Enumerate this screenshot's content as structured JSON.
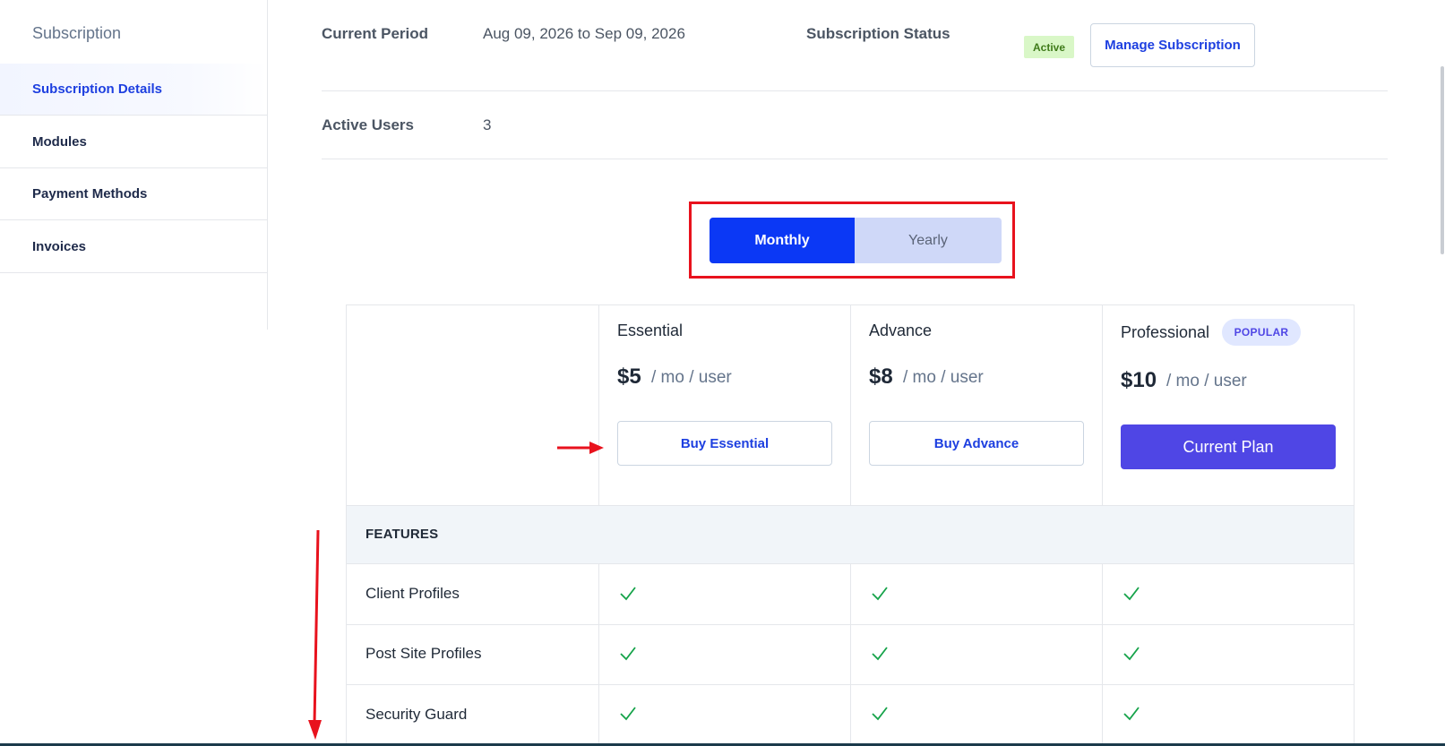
{
  "sidebar": {
    "title": "Subscription",
    "items": [
      {
        "label": "Subscription Details",
        "active": true
      },
      {
        "label": "Modules",
        "active": false
      },
      {
        "label": "Payment Methods",
        "active": false
      },
      {
        "label": "Invoices",
        "active": false
      }
    ]
  },
  "info": {
    "current_period_label": "Current Period",
    "current_period_value": "Aug 09, 2026 to Sep 09, 2026",
    "status_label": "Subscription Status",
    "status_badge": "Active",
    "manage_button": "Manage Subscription",
    "active_users_label": "Active Users",
    "active_users_value": "3"
  },
  "billing_toggle": {
    "monthly": "Monthly",
    "yearly": "Yearly",
    "selected": "Monthly"
  },
  "plans": [
    {
      "name": "Essential",
      "price": "$5",
      "per": "/ mo / user",
      "button": "Buy Essential"
    },
    {
      "name": "Advance",
      "price": "$8",
      "per": "/ mo / user",
      "button": "Buy Advance"
    },
    {
      "name": "Professional",
      "badge": "POPULAR",
      "price": "$10",
      "per": "/ mo / user",
      "button": "Current Plan"
    }
  ],
  "features": {
    "header": "FEATURES",
    "rows": [
      {
        "name": "Client Profiles",
        "essential": true,
        "advance": true,
        "professional": true
      },
      {
        "name": "Post Site Profiles",
        "essential": true,
        "advance": true,
        "professional": true
      },
      {
        "name": "Security Guard",
        "essential": true,
        "advance": true,
        "professional": true
      }
    ]
  },
  "colors": {
    "accent": "#0b38f5",
    "link": "#1d3fe0",
    "current_plan": "#4f46e5",
    "check": "#16a34a",
    "annotation": "#e8121d"
  }
}
